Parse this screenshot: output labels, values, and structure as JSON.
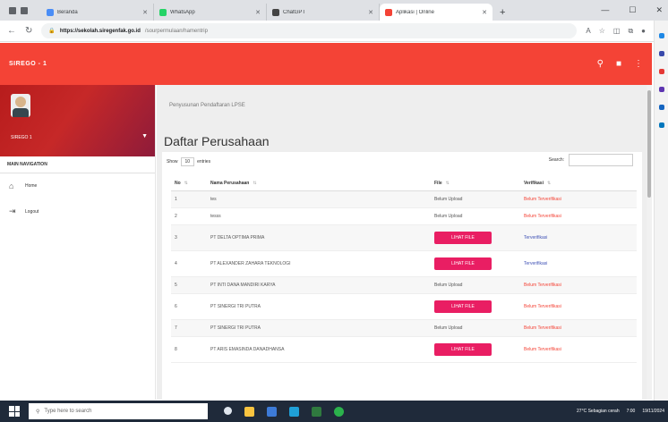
{
  "browser": {
    "tabs": [
      {
        "label": "Beranda",
        "fav": "#4a8df6"
      },
      {
        "label": "WhatsApp",
        "fav": "#25d366"
      },
      {
        "label": "ChatGPT",
        "fav": "#444444"
      },
      {
        "label": "Aplikasi | Online",
        "fav": "#f44336"
      }
    ],
    "new_tab": "+",
    "url_host": "https://sekolah.siregenfak.go.id",
    "url_path": "/sourpermulaan/hamentrip"
  },
  "app": {
    "brand": "SIREGO - 1",
    "accent": "#f44336"
  },
  "sidebar": {
    "user_name": "SIREGO 1",
    "main_nav": "MAIN NAVIGATION",
    "items": [
      {
        "label": "Home",
        "icon": "home-icon"
      },
      {
        "label": "Logout",
        "icon": "logout-icon"
      }
    ]
  },
  "content": {
    "breadcrumb": "Penyusunan Pendaftaran LPSE",
    "title": "Daftar Perusahaan",
    "show_label": "Show",
    "show_value": "10",
    "entries_label": "entries",
    "search_label": "Search:",
    "columns": {
      "no": "No",
      "name": "Nama Perusahaan",
      "file": "File",
      "status": "Verifikasi"
    },
    "lihat_file": "LIHAT FILE",
    "rows": [
      {
        "no": "1",
        "name": "tes",
        "file_text": "Belum Upload",
        "has_button": false,
        "status": "Belum Terverifikasi",
        "verified": false
      },
      {
        "no": "2",
        "name": "tesss",
        "file_text": "Belum Upload",
        "has_button": false,
        "status": "Belum Terverifikasi",
        "verified": false
      },
      {
        "no": "3",
        "name": "PT DELTA OPTIMA PRIMA",
        "file_text": "",
        "has_button": true,
        "status": "Terverifikasi",
        "verified": true
      },
      {
        "no": "4",
        "name": "PT ALEXANDER ZAHARA TEKNOLOGI",
        "file_text": "",
        "has_button": true,
        "status": "Terverifikasi",
        "verified": true
      },
      {
        "no": "5",
        "name": "PT INTI DANA MANDIRI KARYA",
        "file_text": "Belum Upload",
        "has_button": false,
        "status": "Belum Terverifikasi",
        "verified": false
      },
      {
        "no": "6",
        "name": "PT SINERGI TRI PUTRA",
        "file_text": "",
        "has_button": true,
        "status": "Belum Terverifikasi",
        "verified": false
      },
      {
        "no": "7",
        "name": "PT SINERGI TRI PUTRA",
        "file_text": "Belum Upload",
        "has_button": false,
        "status": "Belum Terverifikasi",
        "verified": false
      },
      {
        "no": "8",
        "name": "PT ARIS EMASINDA DANADHANSA",
        "file_text": "",
        "has_button": true,
        "status": "Belum Terverifikasi",
        "verified": false
      }
    ]
  },
  "taskbar": {
    "search_placeholder": "Type here to search",
    "weather": "27°C  Sebagian cerah",
    "time": "7:00",
    "date": "19/11/2024"
  },
  "colors": {
    "button": "#e91e63",
    "status_unverified": "#f44336",
    "status_verified": "#3f51b5"
  }
}
